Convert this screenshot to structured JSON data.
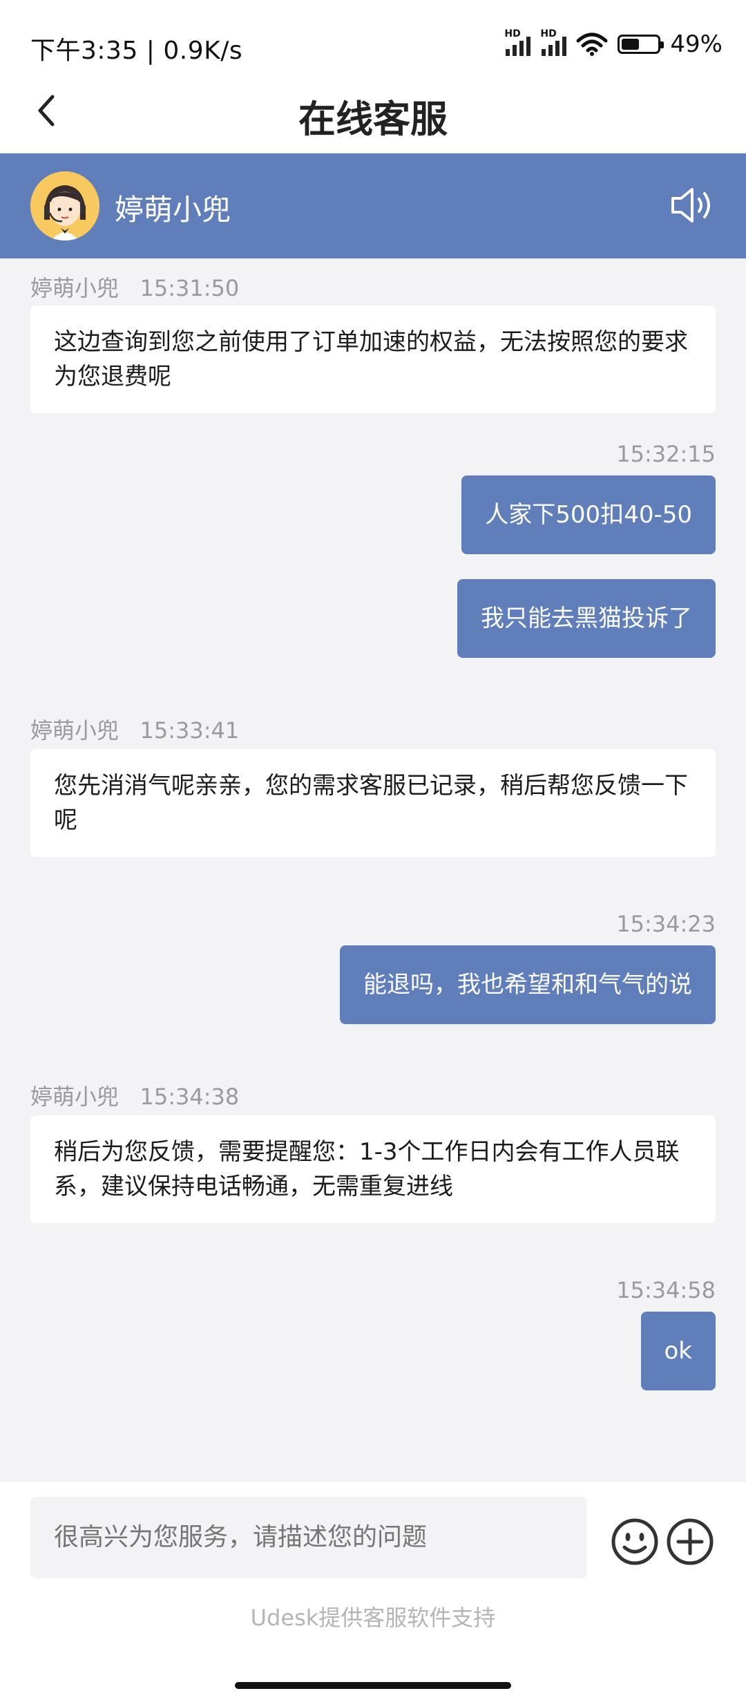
{
  "status": {
    "time_net": "下午3:35 | 0.9K/s",
    "signal1_label": "HD",
    "signal2_label": "HD",
    "battery_percent": "49%",
    "battery_level": 0.49
  },
  "nav": {
    "title": "在线客服",
    "back_icon": "chevron-left-icon"
  },
  "agent": {
    "name": "婷萌小兜",
    "avatar_icon": "headset-agent-avatar",
    "speaker_icon": "speaker-icon"
  },
  "messages": [
    {
      "from": "agent",
      "sender": "婷萌小兜",
      "time": "15:31:50",
      "text": "这边查询到您之前使用了订单加速的权益，无法按照您的要求为您退费呢"
    },
    {
      "from": "user",
      "time": "15:32:15",
      "text": "人家下500扣40-50"
    },
    {
      "from": "user",
      "text": "我只能去黑猫投诉了"
    },
    {
      "from": "agent",
      "sender": "婷萌小兜",
      "time": "15:33:41",
      "text": "您先消消气呢亲亲，您的需求客服已记录，稍后帮您反馈一下呢"
    },
    {
      "from": "user",
      "time": "15:34:23",
      "text": "能退吗，我也希望和和气气的说"
    },
    {
      "from": "agent",
      "sender": "婷萌小兜",
      "time": "15:34:38",
      "text": "稍后为您反馈，需要提醒您：1-3个工作日内会有工作人员联系，建议保持电话畅通，无需重复进线"
    },
    {
      "from": "user",
      "time": "15:34:58",
      "text": "ok"
    }
  ],
  "input": {
    "placeholder": "很高兴为您服务，请描述您的问题",
    "emoji_icon": "emoji-icon",
    "plus_icon": "plus-icon"
  },
  "footer": {
    "powered_by": "Udesk提供客服软件支持"
  },
  "colors": {
    "accent": "#5f7eba",
    "background": "#f3f3f5",
    "bubble_agent": "#ffffff",
    "meta_text": "#9a9a9a"
  }
}
